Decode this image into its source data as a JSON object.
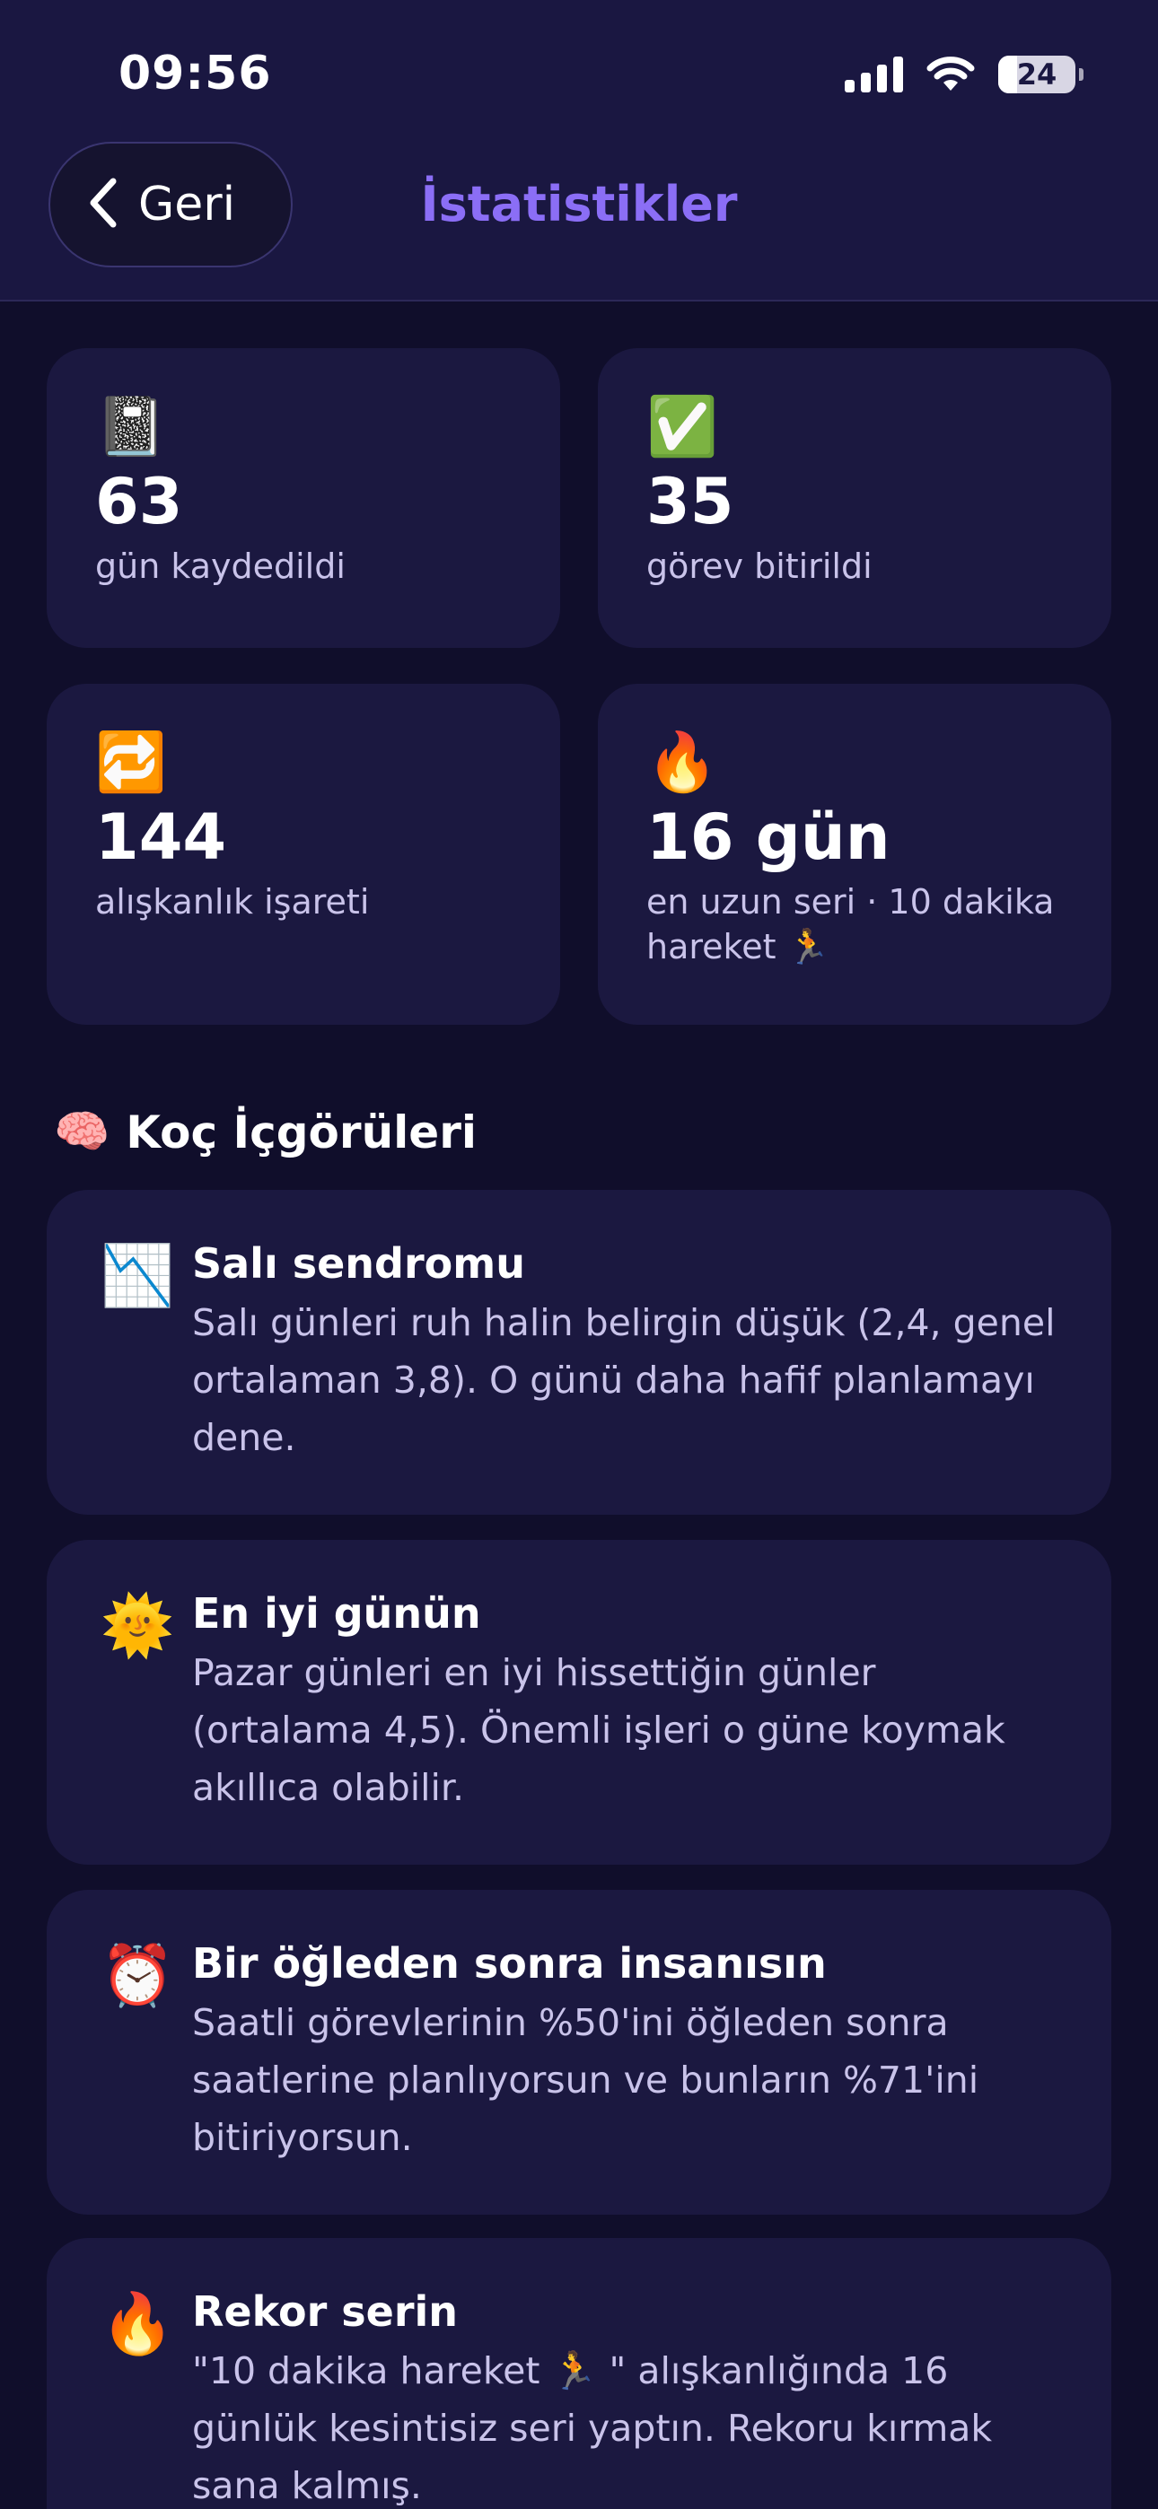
{
  "status_bar": {
    "time": "09:56",
    "battery_text": "24",
    "battery_level": 0.24
  },
  "nav": {
    "back_label": "Geri",
    "title": "İstatistikler",
    "title_color": "#8b6ef6"
  },
  "stats": [
    {
      "icon": "notebook-icon",
      "emoji": "📓",
      "value": "63",
      "label": "gün kaydedildi"
    },
    {
      "icon": "check-mark-icon",
      "emoji": "✅",
      "value": "35",
      "label": "görev bitirildi"
    },
    {
      "icon": "repeat-icon",
      "emoji": "🔁",
      "value": "144",
      "label": "alışkanlık işareti"
    },
    {
      "icon": "fire-icon",
      "emoji": "🔥",
      "value": "16 gün",
      "label": "en uzun seri · 10 dakika hareket 🏃"
    }
  ],
  "insights_section": {
    "icon": "brain-icon",
    "emoji": "🧠",
    "title": "Koç İçgörüleri"
  },
  "insights": [
    {
      "icon": "chart-decreasing-icon",
      "emoji": "📉",
      "title": "Salı sendromu",
      "text": "Salı günleri ruh halin belirgin düşük (2,4, genel ortalaman 3,8). O günü daha hafif planlamayı dene."
    },
    {
      "icon": "sun-face-icon",
      "emoji": "🌞",
      "title": "En iyi günün",
      "text": "Pazar günleri en iyi hissettiğin günler (ortalama 4,5). Önemli işleri o güne koymak akıllıca olabilir."
    },
    {
      "icon": "alarm-clock-icon",
      "emoji": "⏰",
      "title": "Bir öğleden sonra insanısın",
      "text": "Saatli görevlerinin %50'ini öğleden sonra saatlerine planlıyorsun ve bunların %71'ini bitiriyorsun."
    },
    {
      "icon": "fire-icon",
      "emoji": "🔥",
      "title": "Rekor serin",
      "text": "\"10 dakika hareket 🏃 \" alışkanlığında 16 günlük kesintisiz seri yaptın. Rekoru kırmak sana kalmış."
    }
  ]
}
